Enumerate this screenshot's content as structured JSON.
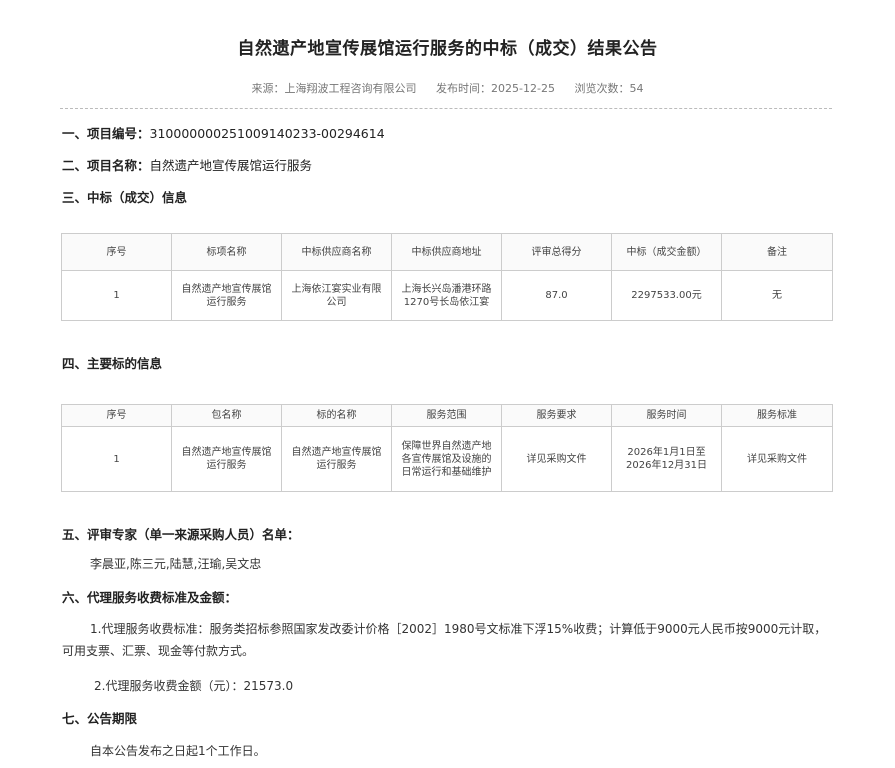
{
  "title": "自然遗产地宣传展馆运行服务的中标（成交）结果公告",
  "meta": {
    "source": "来源：上海翔波工程咨询有限公司",
    "publish_time": "发布时间：2025-12-25",
    "views": "浏览次数：54"
  },
  "section1": {
    "label": "一、项目编号：",
    "value": "310000000251009140233-00294614"
  },
  "section2": {
    "label": "二、项目名称：",
    "value": "自然遗产地宣传展馆运行服务"
  },
  "section3": {
    "label": "三、中标（成交）信息"
  },
  "table1": {
    "headers": [
      "序号",
      "标项名称",
      "中标供应商名称",
      "中标供应商地址",
      "评审总得分",
      "中标（成交金额）",
      "备注"
    ],
    "row": [
      "1",
      "自然遗产地宣传展馆运行服务",
      "上海依江宴实业有限公司",
      "上海长兴岛潘港环路1270号长岛依江宴",
      "87.0",
      "2297533.00元",
      "无"
    ]
  },
  "section4": {
    "label": "四、主要标的信息"
  },
  "table2": {
    "headers": [
      "序号",
      "包名称",
      "标的名称",
      "服务范围",
      "服务要求",
      "服务时间",
      "服务标准"
    ],
    "row": [
      "1",
      "自然遗产地宣传展馆运行服务",
      "自然遗产地宣传展馆运行服务",
      "保障世界自然遗产地各宣传展馆及设施的日常运行和基础维护",
      "详见采购文件",
      "2026年1月1日至2026年12月31日",
      "详见采购文件"
    ]
  },
  "section5": {
    "label": "五、评审专家（单一来源采购人员）名单：",
    "content": "李晨亚,陈三元,陆慧,汪瑜,吴文忠"
  },
  "section6": {
    "label": "六、代理服务收费标准及金额：",
    "item1": "1.代理服务收费标准：服务类招标参照国家发改委计价格［2002］1980号文标准下浮15%收费；计算低于9000元人民币按9000元计取，可用支票、汇票、现金等付款方式。",
    "item2": "2.代理服务收费金额（元）：21573.0"
  },
  "section7": {
    "label": "七、公告期限",
    "content": "自本公告发布之日起1个工作日。"
  }
}
